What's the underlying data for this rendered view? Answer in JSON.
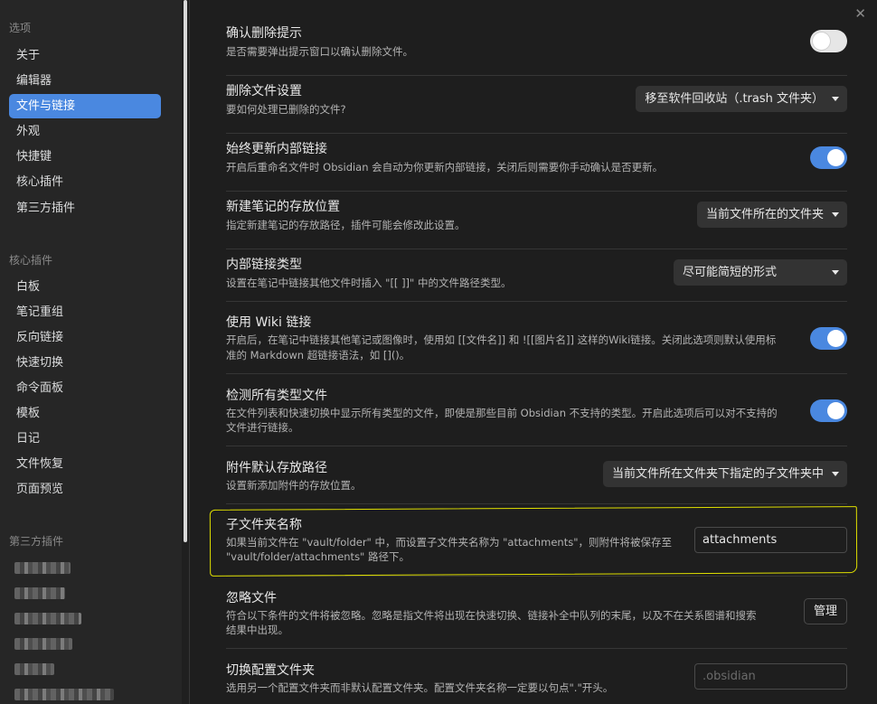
{
  "sidebar": {
    "heading_options": "选项",
    "options": [
      "关于",
      "编辑器",
      "文件与链接",
      "外观",
      "快捷键",
      "核心插件",
      "第三方插件"
    ],
    "active_index": 2,
    "heading_core": "核心插件",
    "core_plugins": [
      "白板",
      "笔记重组",
      "反向链接",
      "快速切换",
      "命令面板",
      "模板",
      "日记",
      "文件恢复",
      "页面预览"
    ],
    "heading_third": "第三方插件"
  },
  "settings": {
    "confirm_delete": {
      "title": "确认删除提示",
      "desc": "是否需要弹出提示窗口以确认删除文件。",
      "enabled": false
    },
    "delete_files": {
      "title": "删除文件设置",
      "desc": "要如何处理已删除的文件?",
      "value": "移至软件回收站（.trash 文件夹）"
    },
    "update_links": {
      "title": "始终更新内部链接",
      "desc": "开启后重命名文件时 Obsidian 会自动为你更新内部链接，关闭后则需要你手动确认是否更新。",
      "enabled": true
    },
    "new_note_location": {
      "title": "新建笔记的存放位置",
      "desc": "指定新建笔记的存放路径，插件可能会修改此设置。",
      "value": "当前文件所在的文件夹"
    },
    "link_format": {
      "title": "内部链接类型",
      "desc": "设置在笔记中链接其他文件时插入 \"[[ ]]\" 中的文件路径类型。",
      "value": "尽可能简短的形式"
    },
    "wiki_links": {
      "title": "使用 Wiki 链接",
      "desc_line1": "开启后，在笔记中链接其他笔记或图像时，使用如 [[文件名]] 和 ![[图片名]] 这样的Wiki链接。关闭此选项则默认使用标",
      "desc_line2": "准的 Markdown 超链接语法，如 []()。",
      "enabled": true
    },
    "detect_all": {
      "title": "检测所有类型文件",
      "desc_line1": "在文件列表和快速切换中显示所有类型的文件，即使是那些目前 Obsidian 不支持的类型。开启此选项后可以对不支持的",
      "desc_line2": "文件进行链接。",
      "enabled": true
    },
    "attachment_location": {
      "title": "附件默认存放路径",
      "desc": "设置新添加附件的存放位置。",
      "value": "当前文件所在文件夹下指定的子文件夹中"
    },
    "subfolder_name": {
      "title": "子文件夹名称",
      "desc_line1": "如果当前文件在 \"vault/folder\" 中，而设置子文件夹名称为 \"attachments\"，则附件将被保存至",
      "desc_line2": "\"vault/folder/attachments\" 路径下。",
      "value": "attachments"
    },
    "excluded_files": {
      "title": "忽略文件",
      "desc_line1": "符合以下条件的文件将被忽略。忽略是指文件将出现在快速切换、链接补全中队列的末尾，以及不在关系图谱和搜索",
      "desc_line2": "结果中出现。",
      "button": "管理"
    },
    "config_folder": {
      "title": "切换配置文件夹",
      "desc": "选用另一个配置文件夹而非默认配置文件夹。配置文件夹名称一定要以句点\".\"开头。",
      "placeholder": ".obsidian"
    }
  },
  "icons": {
    "close": "close-icon",
    "dropdown": "chevron-down-icon"
  },
  "colors": {
    "accent": "#4a88e0",
    "highlight": "#e0e000"
  }
}
